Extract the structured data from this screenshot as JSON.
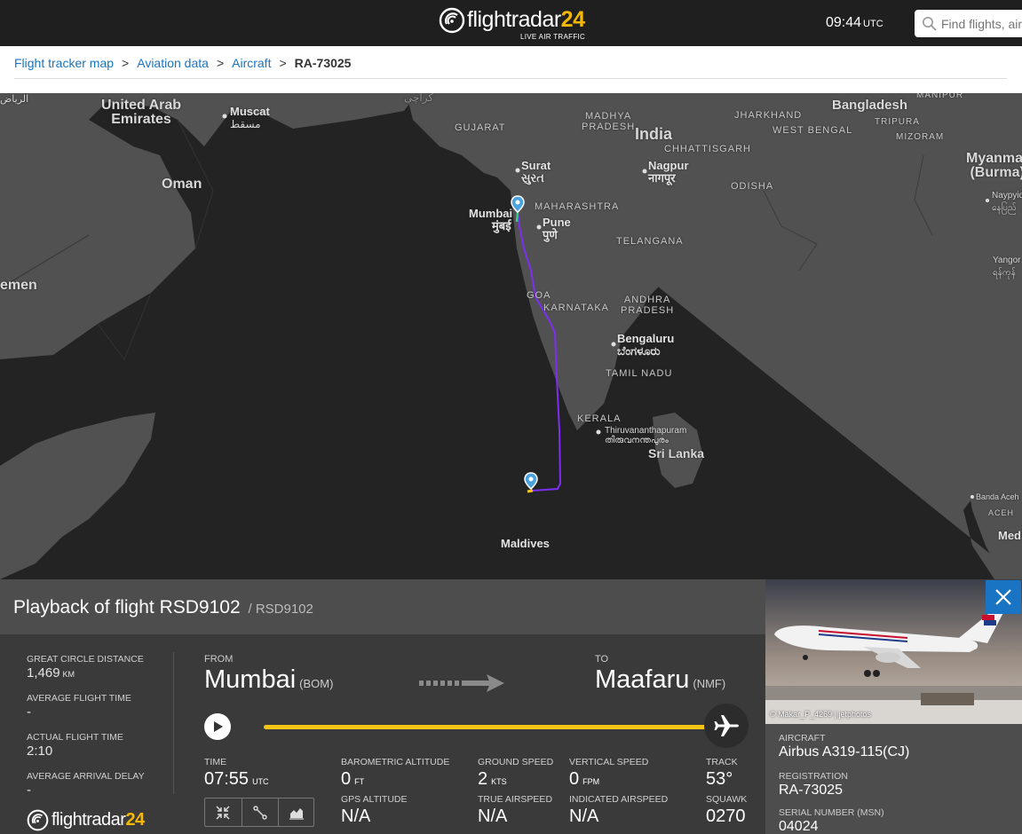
{
  "header": {
    "brand": "flightradar",
    "brand_num": "24",
    "tagline": "LIVE AIR TRAFFIC",
    "time": "09:44",
    "time_zone": "UTC",
    "search_placeholder": "Find flights, airports and more"
  },
  "breadcrumb": {
    "items": [
      "Flight tracker map",
      "Aviation data",
      "Aircraft"
    ],
    "separator": ">",
    "current": "RA-73025"
  },
  "map": {
    "labels": {
      "uae": "United Arab\nEmirates",
      "muscat": "Muscat",
      "muscat_ar": "مسقط",
      "oman": "Oman",
      "yemen": "emen",
      "riyadh_ar": "الرياض",
      "karachi_ar": "کراچی",
      "gujarat": "GUJARAT",
      "madhya": "MADHYA\nPRADESH",
      "india": "India",
      "jharkhand": "JHARKHAND",
      "bangladesh": "Bangladesh",
      "westbengal": "WEST BENGAL",
      "tripura": "TRIPURA",
      "manipur": "MANIPUR",
      "mizoram": "MIZORAM",
      "myanmar": "Myanmar\n(Burma)",
      "chhattisgarh": "CHHATTISGARH",
      "odisha": "ODISHA",
      "surat": "Surat",
      "surat_local": "સુરત",
      "nagpur": "Nagpur",
      "nagpur_local": "नागपूर",
      "maharashtra": "MAHARASHTRA",
      "mumbai": "Mumbai",
      "mumbai_local": "मुंबई",
      "pune": "Pune",
      "pune_local": "पुणे",
      "telangana": "TELANGANA",
      "goa": "GOA",
      "karnataka": "KARNATAKA",
      "andhra": "ANDHRA\nPRADESH",
      "bengaluru": "Bengaluru",
      "bengaluru_local": "ಬೆಂಗಳೂರು",
      "tamilnadu": "TAMIL NADU",
      "kerala": "KERALA",
      "thiruvananthapuram": "Thiruvananthapuram",
      "thiruvananthapuram_local": "തിരുവനന്തപുരം",
      "srilanka": "Sri Lanka",
      "maldives": "Maldives",
      "naypyidaw": "Naypyid",
      "naypyidaw_local": "နေပြည်",
      "yangon": "Yangor",
      "yangon_local": "ရန်ကုန်",
      "bandaaceh": "Banda Aceh",
      "aceh": "ACEH",
      "medan": "Med"
    },
    "colors": {
      "water": "#232323",
      "land": "#515151",
      "track": "#7b2ff0"
    }
  },
  "playback": {
    "title": "Playback of flight RSD9102",
    "callsign": "/ RSD9102",
    "stats": [
      {
        "label": "GREAT CIRCLE DISTANCE",
        "value": "1,469",
        "unit": "KM"
      },
      {
        "label": "AVERAGE FLIGHT TIME",
        "value": "-",
        "unit": ""
      },
      {
        "label": "ACTUAL FLIGHT TIME",
        "value": "2:10",
        "unit": ""
      },
      {
        "label": "AVERAGE ARRIVAL DELAY",
        "value": "-",
        "unit": ""
      }
    ],
    "from_label": "FROM",
    "from_city": "Mumbai",
    "from_code": "(BOM)",
    "to_label": "TO",
    "to_city": "Maafaru",
    "to_code": "(NMF)",
    "progress": 1.0,
    "metrics": {
      "time": {
        "label": "TIME",
        "value": "07:55",
        "unit": "UTC"
      },
      "baro_alt": {
        "label": "BAROMETRIC ALTITUDE",
        "value": "0",
        "unit": "FT"
      },
      "gps_alt": {
        "label": "GPS ALTITUDE",
        "value": "N/A"
      },
      "ground_speed": {
        "label": "GROUND SPEED",
        "value": "2",
        "unit": "KTS"
      },
      "true_airspeed": {
        "label": "TRUE AIRSPEED",
        "value": "N/A"
      },
      "vertical_speed": {
        "label": "VERTICAL SPEED",
        "value": "0",
        "unit": "FPM"
      },
      "indicated_airspeed": {
        "label": "INDICATED AIRSPEED",
        "value": "N/A"
      },
      "track": {
        "label": "TRACK",
        "value": "53°"
      },
      "squawk": {
        "label": "SQUAWK",
        "value": "0270"
      }
    },
    "footer_brand": "flightradar",
    "footer_brand_num": "24"
  },
  "aircraft": {
    "photo_credit": "© Makar_P_4269 | jetphotos",
    "aircraft_label": "AIRCRAFT",
    "aircraft_value": "Airbus A319-115(CJ)",
    "registration_label": "REGISTRATION",
    "registration_value": "RA-73025",
    "msn_label": "SERIAL NUMBER (MSN)",
    "msn_value": "04024"
  }
}
